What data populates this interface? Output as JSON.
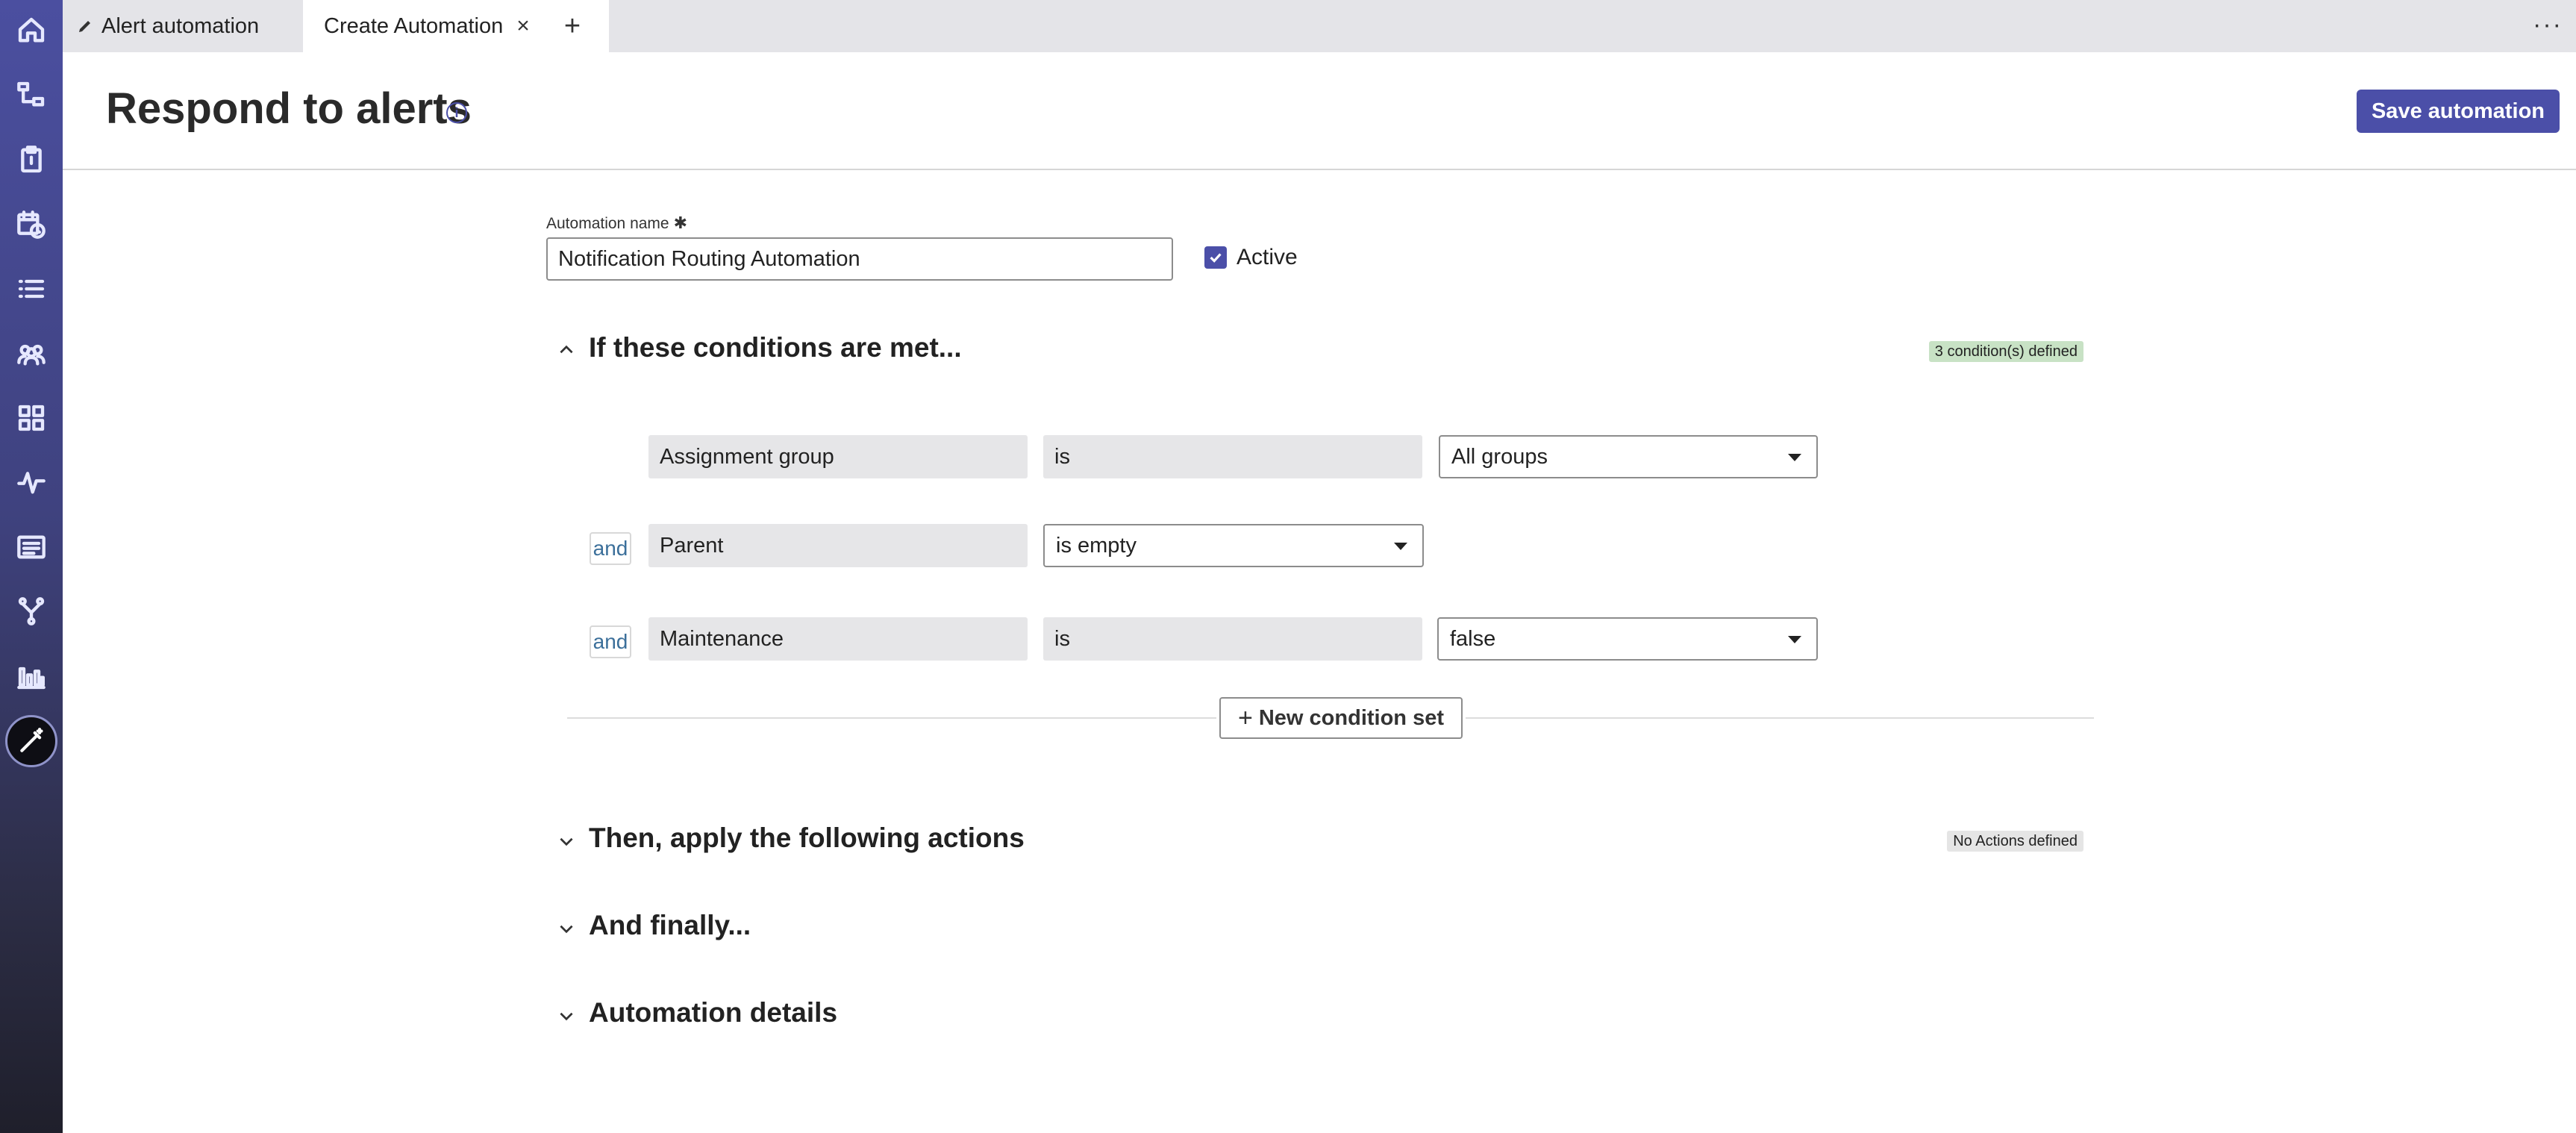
{
  "tabs": [
    {
      "label": "Alert automation",
      "icon": "pencil-icon"
    },
    {
      "label": "Create Automation",
      "icon": "close-icon"
    }
  ],
  "tab_actions": {
    "add": "+",
    "more": "···"
  },
  "header": {
    "title": "Respond to alerts",
    "info_icon": "i",
    "save_label": "Save automation"
  },
  "form": {
    "name_label": "Automation name",
    "name_required": "✱",
    "name_value": "Notification Routing Automation",
    "active_label": "Active",
    "active_checked": true
  },
  "conditions": {
    "title": "If these conditions are met...",
    "badge": "3 condition(s) defined",
    "rows": [
      {
        "connector": "",
        "field": "Assignment group",
        "operator": "is",
        "value": "All groups"
      },
      {
        "connector": "and",
        "field": "Parent",
        "operator": "is empty",
        "value": ""
      },
      {
        "connector": "and",
        "field": "Maintenance",
        "operator": "is",
        "value": "false"
      }
    ],
    "new_set_label": "New condition set"
  },
  "actions": {
    "title": "Then, apply the following actions",
    "badge": "No Actions defined"
  },
  "finally": {
    "title": "And finally..."
  },
  "details": {
    "title": "Automation details"
  },
  "colors": {
    "accent": "#4b4fa8",
    "badge_green": "#c8e2c5",
    "rail_top": "#4b4fa0",
    "rail_bottom": "#1f1f2b"
  },
  "nav_icons": [
    "home-icon",
    "hierarchy-icon",
    "clipboard-icon",
    "calendar-clock-icon",
    "list-icon",
    "people-icon",
    "grid-icon",
    "pulse-icon",
    "table-icon",
    "branch-icon",
    "bar-chart-icon",
    "wand-icon"
  ]
}
